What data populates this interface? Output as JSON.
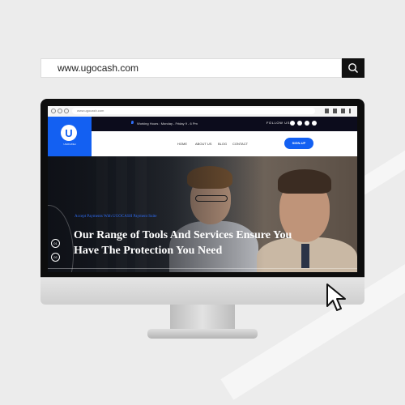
{
  "search": {
    "text": "www.ugocash.com"
  },
  "browser": {
    "url": "www.ugocash.com"
  },
  "site": {
    "hours": "Working Hours : Monday - Friday 9 - 6 Pm",
    "follow_label": "FOLLOW US",
    "logo_letter": "U",
    "logo_label": "UGOCASH",
    "nav": [
      "HOME",
      "ABOUT US",
      "BLOG",
      "CONTACT"
    ],
    "signup_label": "SIGN-UP",
    "hero_tag": "Accept Payments With UGOCASH Payment Suite",
    "hero_title": "Our Range of Tools And Services Ensure You Have The Protection You Need",
    "pager": [
      "01",
      "02"
    ]
  },
  "colors": {
    "brand_blue": "#1360f2",
    "topbar": "#0c0c1c"
  }
}
